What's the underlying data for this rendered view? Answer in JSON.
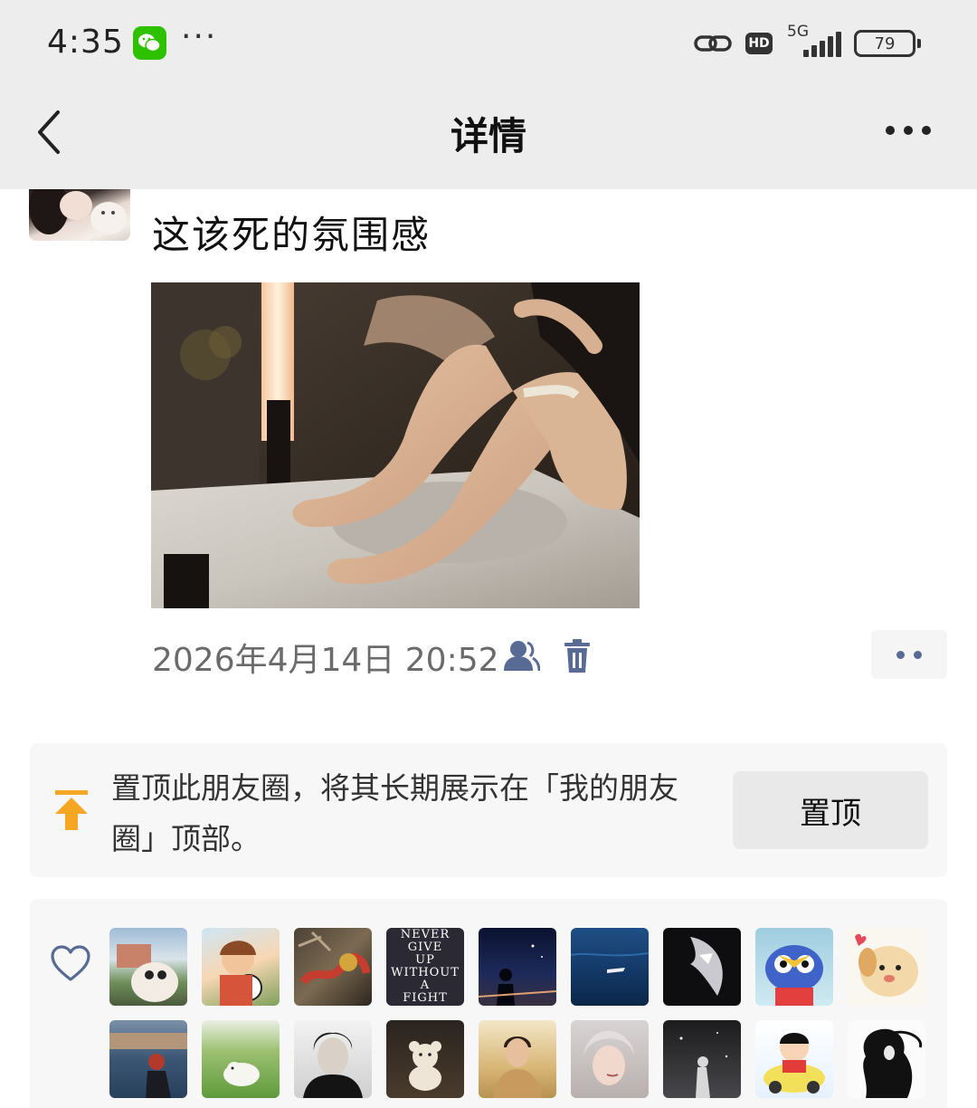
{
  "status_bar": {
    "time": "4:35",
    "notification_dots": "···",
    "hd_label": "HD",
    "network_label": "5G",
    "battery_level": "79",
    "app_icon": "wechat-icon"
  },
  "nav": {
    "title": "详情",
    "back_icon": "chevron-left-icon",
    "more_icon": "more-horizontal-icon"
  },
  "post": {
    "text": "这该死的氛围感",
    "timestamp": "2026年4月14日 20:52",
    "privacy_icon": "contacts-visibility-icon",
    "delete_icon": "trash-icon",
    "more_icon": "comment-like-menu-icon"
  },
  "pin_card": {
    "description": "置顶此朋友圈，将其长期展示在「我的朋友圈」顶部。",
    "button_label": "置顶",
    "icon": "pin-to-top-icon"
  },
  "likes": {
    "icon": "heart-outline-icon",
    "liker_avatar_texts": [
      "",
      "",
      "",
      "NEVER\nGIVE\nUP\nWITHOUT\nA\nFIGHT",
      "",
      "",
      "",
      "",
      "",
      "",
      "",
      "",
      "",
      "",
      "",
      "",
      "",
      ""
    ]
  },
  "colors": {
    "wechat_green": "#2dc100",
    "link_blue": "#576b95",
    "pin_orange": "#f5a623",
    "card_bg": "#f7f7f7",
    "header_bg": "#ededed"
  }
}
